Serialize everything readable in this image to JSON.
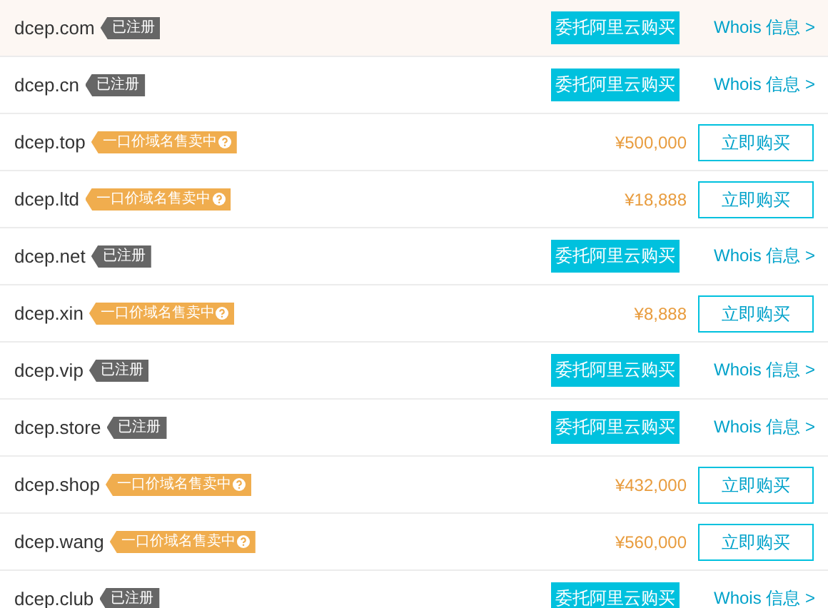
{
  "domains": [
    {
      "domain": "dcep.com",
      "kind": "registered",
      "tag": "已注册",
      "highlighted": true,
      "action": "委托阿里云购买",
      "link": "Whois 信息 >"
    },
    {
      "domain": "dcep.cn",
      "kind": "registered",
      "tag": "已注册",
      "highlighted": false,
      "action": "委托阿里云购买",
      "link": "Whois 信息 >"
    },
    {
      "domain": "dcep.top",
      "kind": "for_sale",
      "tag": "一口价域名售卖中",
      "highlighted": false,
      "price": "¥500,000",
      "action": "立即购买"
    },
    {
      "domain": "dcep.ltd",
      "kind": "for_sale",
      "tag": "一口价域名售卖中",
      "highlighted": false,
      "price": "¥18,888",
      "action": "立即购买"
    },
    {
      "domain": "dcep.net",
      "kind": "registered",
      "tag": "已注册",
      "highlighted": false,
      "action": "委托阿里云购买",
      "link": "Whois 信息 >"
    },
    {
      "domain": "dcep.xin",
      "kind": "for_sale",
      "tag": "一口价域名售卖中",
      "highlighted": false,
      "price": "¥8,888",
      "action": "立即购买"
    },
    {
      "domain": "dcep.vip",
      "kind": "registered",
      "tag": "已注册",
      "highlighted": false,
      "action": "委托阿里云购买",
      "link": "Whois 信息 >"
    },
    {
      "domain": "dcep.store",
      "kind": "registered",
      "tag": "已注册",
      "highlighted": false,
      "action": "委托阿里云购买",
      "link": "Whois 信息 >"
    },
    {
      "domain": "dcep.shop",
      "kind": "for_sale",
      "tag": "一口价域名售卖中",
      "highlighted": false,
      "price": "¥432,000",
      "action": "立即购买"
    },
    {
      "domain": "dcep.wang",
      "kind": "for_sale",
      "tag": "一口价域名售卖中",
      "highlighted": false,
      "price": "¥560,000",
      "action": "立即购买"
    },
    {
      "domain": "dcep.club",
      "kind": "registered",
      "tag": "已注册",
      "highlighted": false,
      "action": "委托阿里云购买",
      "link": "Whois 信息 >"
    }
  ]
}
